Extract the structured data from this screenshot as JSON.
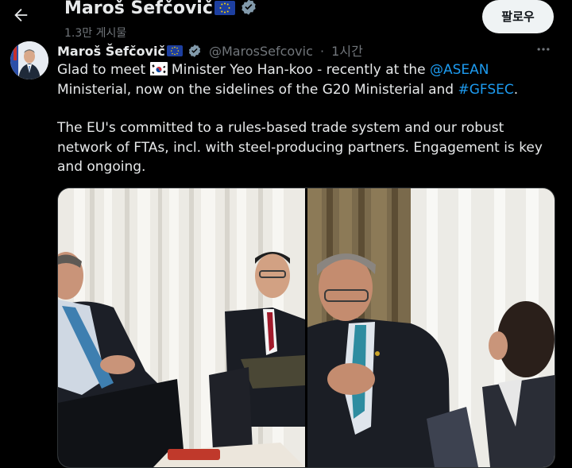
{
  "header": {
    "back_icon": "arrow-left-icon",
    "title": "Maroš Šefčovič",
    "post_count": "1.3만 게시물",
    "follow_label": "팔로우"
  },
  "tweet": {
    "name": "Maroš Šefčovič",
    "handle": "@MarosSefcovic",
    "separator": "·",
    "time": "1시간",
    "more_icon": "more-dots-icon",
    "para1": {
      "t1": "Glad to meet ",
      "t2": " Minister Yeo Han-koo - recently at the ",
      "mention": "@ASEAN",
      "t3": " Ministerial, now on the sidelines of the G20 Ministerial and ",
      "hashtag": "#GFSEC",
      "t4": "."
    },
    "para2": "The EU's committed to a rules-based trade system and our robust network of FTAs, incl. with steel-producing partners. Engagement is key and ongoing."
  },
  "colors": {
    "background": "#000000",
    "text": "#e7e9ea",
    "muted": "#71767b",
    "link": "#1d9bf0",
    "verified": "#829aab",
    "follow_bg": "#eff3f4"
  }
}
